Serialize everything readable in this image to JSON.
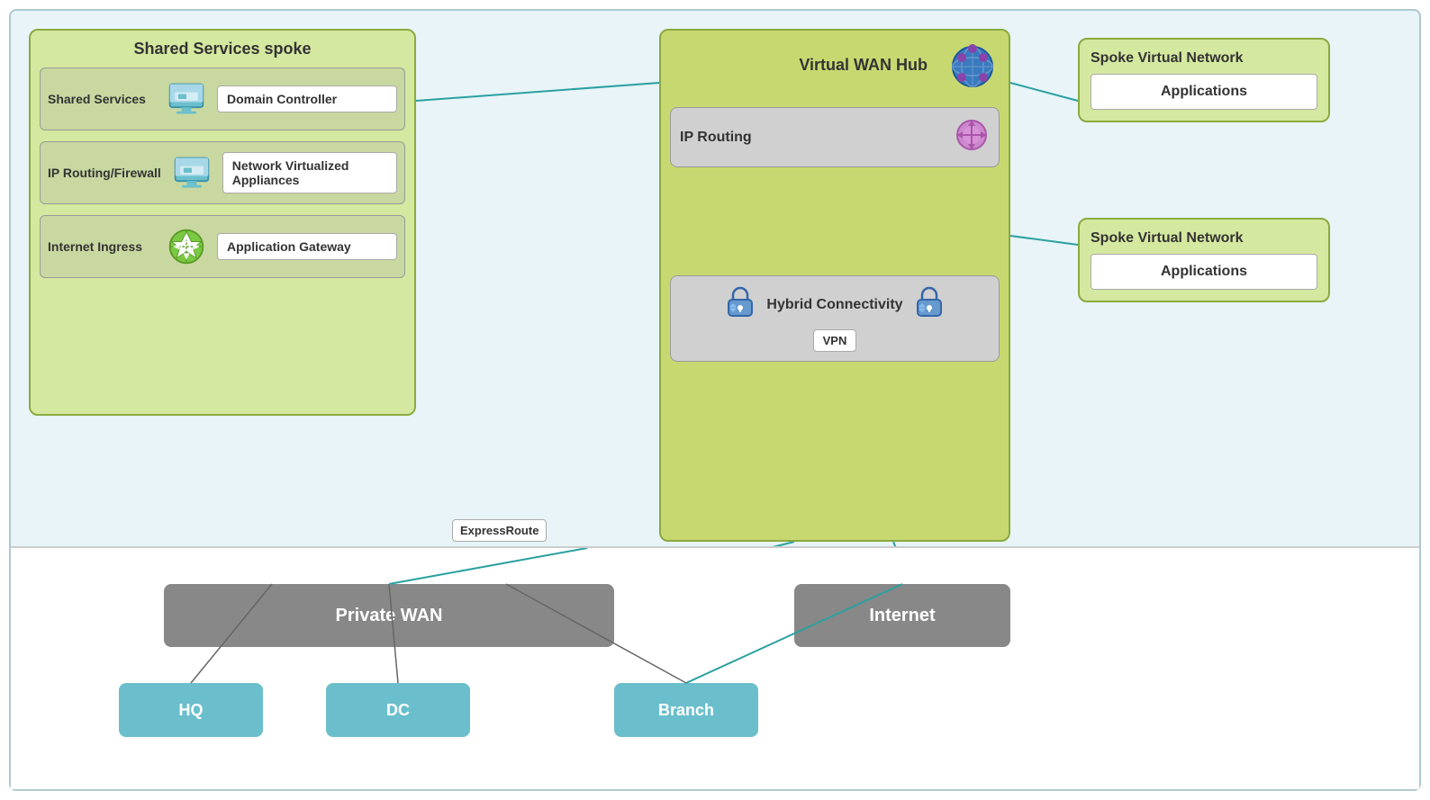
{
  "canvas": {
    "background": "#e8f4f8"
  },
  "shared_services_spoke": {
    "title": "Shared Services spoke",
    "rows": [
      {
        "label": "Shared Services",
        "icon": "monitor",
        "component": "Domain Controller"
      },
      {
        "label": "IP Routing/Firewall",
        "icon": "monitor",
        "component": "Network Virtualized Appliances"
      },
      {
        "label": "Internet Ingress",
        "icon": "globe-green",
        "component": "Application Gateway"
      }
    ]
  },
  "vwan": {
    "title": "Virtual WAN Hub",
    "routing_label": "IP Routing",
    "hybrid_label": "Hybrid Connectivity",
    "vpn_label": "VPN",
    "expressroute_label": "ExpressRoute"
  },
  "spoke_vnets": [
    {
      "title": "Spoke Virtual Network",
      "app_label": "Applications"
    },
    {
      "title": "Spoke Virtual Network",
      "app_label": "Applications"
    }
  ],
  "bottom": {
    "private_wan": "Private WAN",
    "internet": "Internet",
    "terminals": [
      "HQ",
      "DC",
      "Branch"
    ]
  }
}
